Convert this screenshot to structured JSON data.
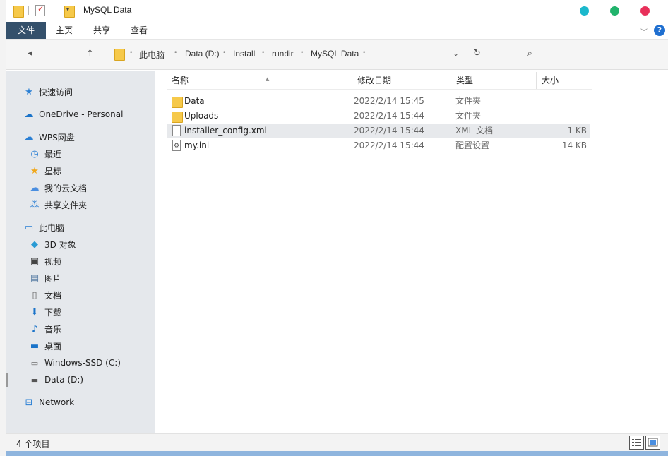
{
  "window": {
    "title": "MySQL Data"
  },
  "ribbon": {
    "tabs": [
      "文件",
      "主页",
      "共享",
      "查看"
    ],
    "help_label": "?"
  },
  "address": {
    "crumbs": [
      "此电脑",
      "Data (D:)",
      "Install",
      "rundir",
      "MySQL Data"
    ],
    "search_glyph": "🔍"
  },
  "sidebar": {
    "items": [
      {
        "label": "快速访问",
        "icon": "star-pin-icon"
      },
      {
        "label": "OneDrive - Personal",
        "icon": "cloud-icon"
      },
      {
        "label": "WPS网盘",
        "icon": "wps-cloud-icon"
      },
      {
        "label": "最近",
        "icon": "clock-icon"
      },
      {
        "label": "星标",
        "icon": "star-icon"
      },
      {
        "label": "我的云文档",
        "icon": "cloud-doc-icon"
      },
      {
        "label": "共享文件夹",
        "icon": "share-folder-icon"
      },
      {
        "label": "此电脑",
        "icon": "computer-icon"
      },
      {
        "label": "3D 对象",
        "icon": "cube-icon"
      },
      {
        "label": "视频",
        "icon": "video-icon"
      },
      {
        "label": "图片",
        "icon": "picture-icon"
      },
      {
        "label": "文档",
        "icon": "document-icon"
      },
      {
        "label": "下载",
        "icon": "download-icon"
      },
      {
        "label": "音乐",
        "icon": "music-icon"
      },
      {
        "label": "桌面",
        "icon": "desktop-icon"
      },
      {
        "label": "Windows-SSD (C:)",
        "icon": "drive-icon"
      },
      {
        "label": "Data (D:)",
        "icon": "drive-icon"
      },
      {
        "label": "Network",
        "icon": "network-icon"
      }
    ]
  },
  "columns": {
    "name": "名称",
    "date": "修改日期",
    "type": "类型",
    "size": "大小"
  },
  "files": [
    {
      "name": "Data",
      "date": "2022/2/14 15:45",
      "type": "文件夹",
      "size": "",
      "icon": "folder-icon"
    },
    {
      "name": "Uploads",
      "date": "2022/2/14 15:44",
      "type": "文件夹",
      "size": "",
      "icon": "folder-icon"
    },
    {
      "name": "installer_config.xml",
      "date": "2022/2/14 15:44",
      "type": "XML 文档",
      "size": "1 KB",
      "icon": "xml-file-icon",
      "selected": true
    },
    {
      "name": "my.ini",
      "date": "2022/2/14 15:44",
      "type": "配置设置",
      "size": "14 KB",
      "icon": "ini-file-icon"
    }
  ],
  "status": {
    "count_text": "4 个项目"
  },
  "colors": {
    "file_tab": "#34506b",
    "sidebar_bg": "#e5e8ec",
    "dot_teal": "#1bb8cc",
    "dot_green": "#21b36c",
    "dot_red": "#e8305a"
  }
}
